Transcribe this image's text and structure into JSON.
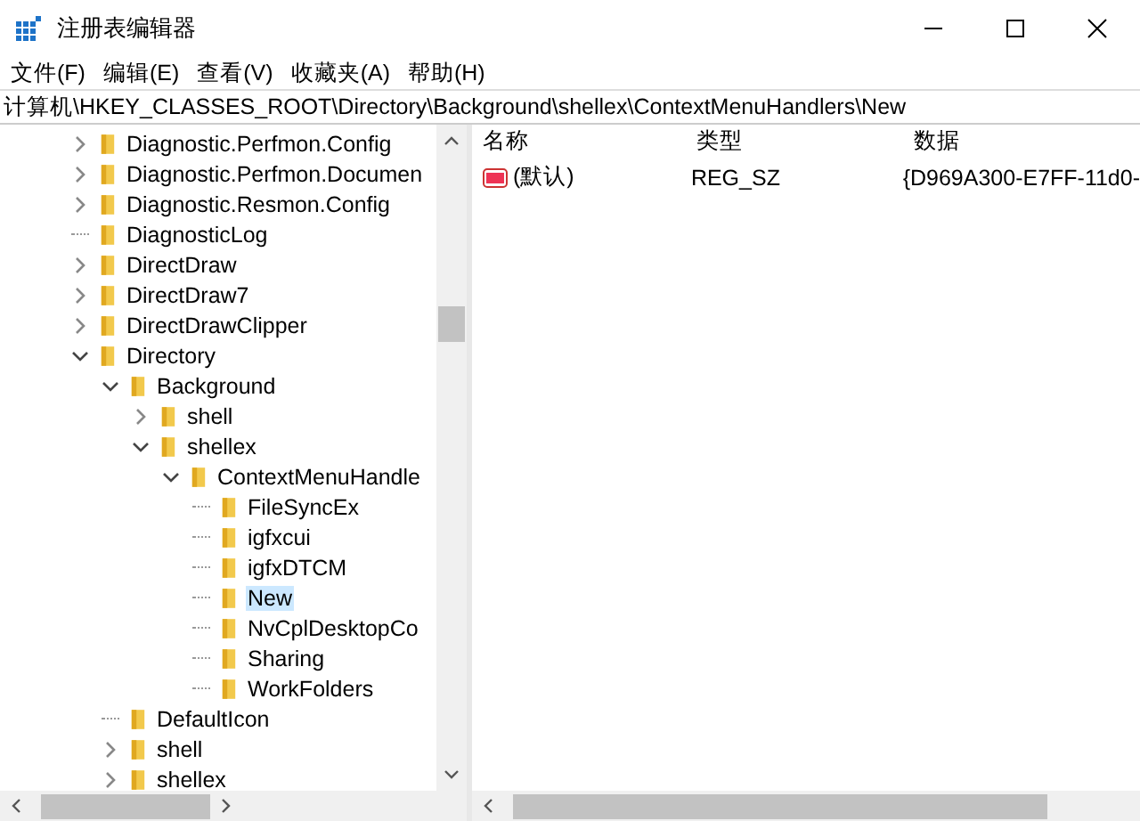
{
  "window": {
    "title": "注册表编辑器"
  },
  "menu": [
    "文件(F)",
    "编辑(E)",
    "查看(V)",
    "收藏夹(A)",
    "帮助(H)"
  ],
  "address": "计算机\\HKEY_CLASSES_ROOT\\Directory\\Background\\shellex\\ContextMenuHandlers\\New",
  "tree": [
    {
      "label": "Diagnostic.Perfmon.Config",
      "kind": "branch",
      "expanded": false,
      "selected": false
    },
    {
      "label": "Diagnostic.Perfmon.Documen",
      "kind": "branch",
      "expanded": false,
      "selected": false
    },
    {
      "label": "Diagnostic.Resmon.Config",
      "kind": "branch",
      "expanded": false,
      "selected": false
    },
    {
      "label": "DiagnosticLog",
      "kind": "leaf",
      "selected": false
    },
    {
      "label": "DirectDraw",
      "kind": "branch",
      "expanded": false,
      "selected": false
    },
    {
      "label": "DirectDraw7",
      "kind": "branch",
      "expanded": false,
      "selected": false
    },
    {
      "label": "DirectDrawClipper",
      "kind": "branch",
      "expanded": false,
      "selected": false
    },
    {
      "label": "Directory",
      "kind": "branch",
      "expanded": true,
      "selected": false,
      "children": [
        {
          "label": "Background",
          "kind": "branch",
          "expanded": true,
          "selected": false,
          "children": [
            {
              "label": "shell",
              "kind": "branch",
              "expanded": false,
              "selected": false
            },
            {
              "label": "shellex",
              "kind": "branch",
              "expanded": true,
              "selected": false,
              "children": [
                {
                  "label": "ContextMenuHandle",
                  "kind": "branch",
                  "expanded": true,
                  "selected": false,
                  "children": [
                    {
                      "label": "FileSyncEx",
                      "kind": "leaf",
                      "selected": false
                    },
                    {
                      "label": "igfxcui",
                      "kind": "leaf",
                      "selected": false
                    },
                    {
                      "label": "igfxDTCM",
                      "kind": "leaf",
                      "selected": false
                    },
                    {
                      "label": "New",
                      "kind": "leaf",
                      "selected": true
                    },
                    {
                      "label": "NvCplDesktopCo",
                      "kind": "leaf",
                      "selected": false
                    },
                    {
                      "label": "Sharing",
                      "kind": "leaf",
                      "selected": false
                    },
                    {
                      "label": "WorkFolders",
                      "kind": "leaf",
                      "selected": false
                    }
                  ]
                }
              ]
            }
          ]
        },
        {
          "label": "DefaultIcon",
          "kind": "leaf",
          "selected": false
        },
        {
          "label": "shell",
          "kind": "branch",
          "expanded": false,
          "selected": false
        },
        {
          "label": "shellex",
          "kind": "branch",
          "expanded": false,
          "selected": false
        }
      ]
    }
  ],
  "table": {
    "columns": [
      "名称",
      "类型",
      "数据"
    ],
    "rows": [
      {
        "name": "(默认)",
        "type": "REG_SZ",
        "data": "{D969A300-E7FF-11d0-"
      }
    ]
  }
}
